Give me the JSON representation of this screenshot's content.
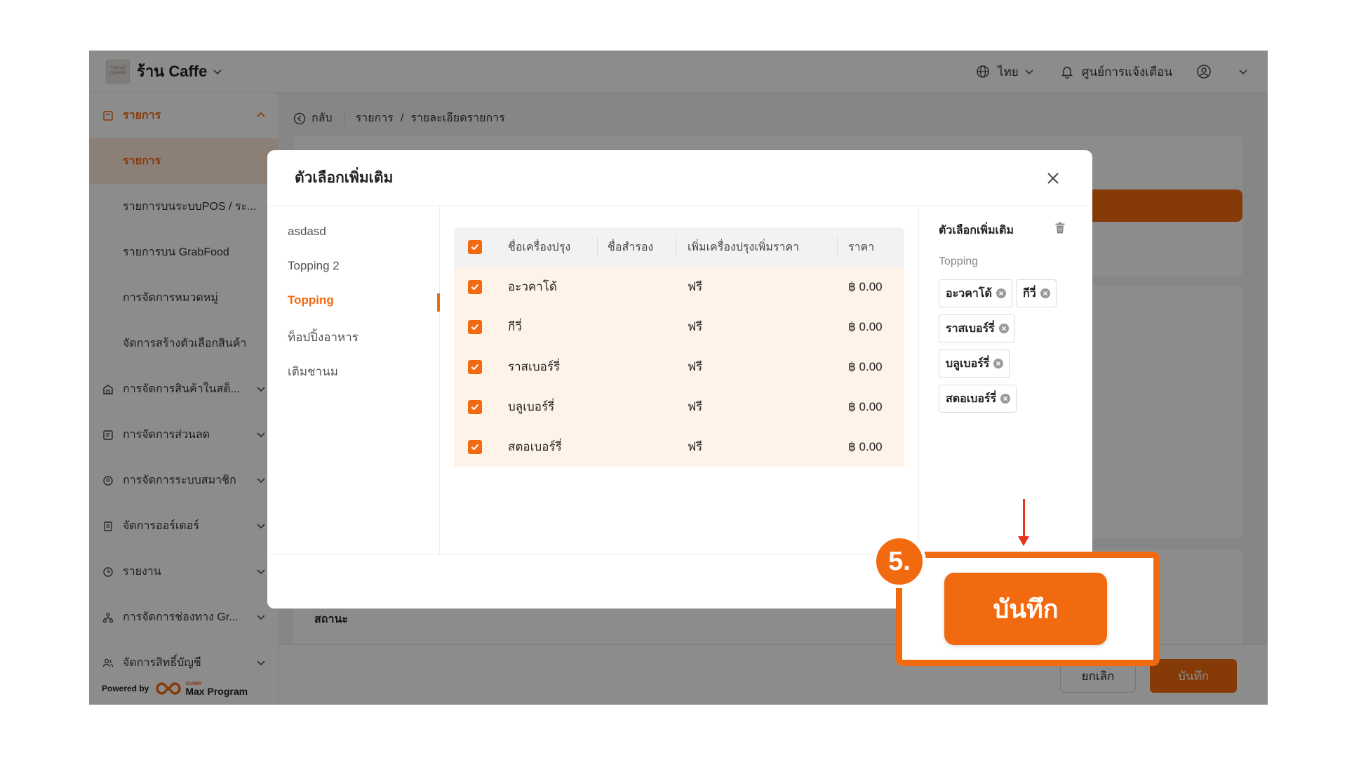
{
  "app": {
    "logo_text": "TOKYO COFFEE",
    "shop_name": "ร้าน Caffe",
    "language": "ไทย",
    "notifications_label": "ศูนย์การแจ้งเตือน"
  },
  "sidebar": {
    "parent_label": "รายการ",
    "sub_items": [
      {
        "label": "รายการ"
      },
      {
        "label": "รายการบนระบบPOS / ระ..."
      },
      {
        "label": "รายการบน GrabFood"
      },
      {
        "label": "การจัดการหมวดหมู่"
      },
      {
        "label": "จัดการสร้างตัวเลือกสินค้า"
      }
    ],
    "items": [
      {
        "label": "การจัดการสินค้าในสต็..."
      },
      {
        "label": "การจัดการส่วนลด"
      },
      {
        "label": "การจัดการระบบสมาชิก"
      },
      {
        "label": "จัดการออร์เดอร์"
      },
      {
        "label": "รายงาน"
      },
      {
        "label": "การจัดการช่องทาง Gr..."
      },
      {
        "label": "จัดการสิทธิ์บัญชี"
      }
    ],
    "powered_by": "Powered by",
    "brand_small": "SUNMI",
    "brand": "Max Program"
  },
  "breadcrumb": {
    "back": "กลับ",
    "path1": "รายการ",
    "sep": "/",
    "path2": "รายละเอียดรายการ"
  },
  "page": {
    "status_label": "สถานะ",
    "cancel_label": "ยกเลิก",
    "save_label": "บันทึก"
  },
  "modal": {
    "title": "ตัวเลือกเพิ่มเติม",
    "groups": [
      "asdasd",
      "Topping 2",
      "Topping",
      "ท็อปปิ้งอาหาร",
      "เติมชานม"
    ],
    "active_group_index": 2,
    "table": {
      "headers": [
        "ชื่อเครื่องปรุง",
        "ชื่อสำรอง",
        "เพิ่มเครื่องปรุงเพิ่มราคา",
        "ราคา"
      ],
      "rows": [
        {
          "name": "อะวคาโด้",
          "alt": "",
          "price_type": "ฟรี",
          "price": "฿ 0.00"
        },
        {
          "name": "กีวี่",
          "alt": "",
          "price_type": "ฟรี",
          "price": "฿ 0.00"
        },
        {
          "name": "ราสเบอร์รี่",
          "alt": "",
          "price_type": "ฟรี",
          "price": "฿ 0.00"
        },
        {
          "name": "บลูเบอร์รี่",
          "alt": "",
          "price_type": "ฟรี",
          "price": "฿ 0.00"
        },
        {
          "name": "สตอเบอร์รี่",
          "alt": "",
          "price_type": "ฟรี",
          "price": "฿ 0.00"
        }
      ]
    },
    "selected": {
      "title": "ตัวเลือกเพิ่มเติม",
      "group_name": "Topping",
      "chips": [
        "อะวคาโด้",
        "กีวี่",
        "ราสเบอร์รี่",
        "บลูเบอร์รี่",
        "สตอเบอร์รี่"
      ]
    }
  },
  "annotation": {
    "step": "5.",
    "save_label": "บันทึก"
  },
  "colors": {
    "accent": "#f26a0f",
    "arrow": "#e8321a",
    "row_highlight": "#fef3e8"
  }
}
